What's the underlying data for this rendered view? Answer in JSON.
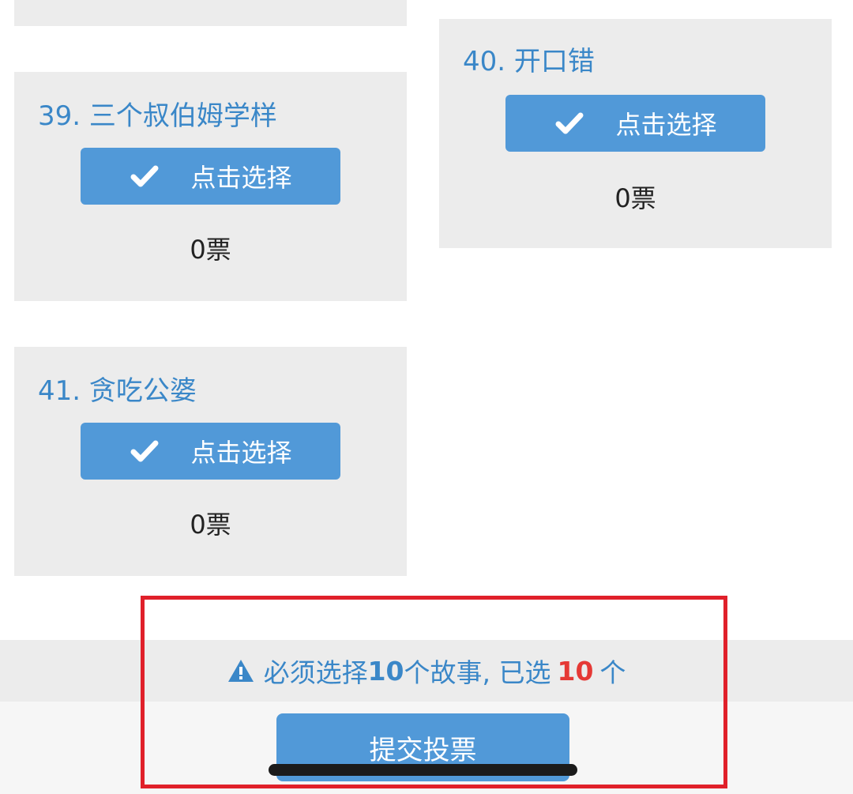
{
  "stories": [
    {
      "title": "39. 三个叔伯姆学样",
      "select_label": "点击选择",
      "votes": "0票"
    },
    {
      "title": "40. 开口错",
      "select_label": "点击选择",
      "votes": "0票"
    },
    {
      "title": "41. 贪吃公婆",
      "select_label": "点击选择",
      "votes": "0票"
    }
  ],
  "notice": {
    "prefix": "必须选择",
    "required_count": "10",
    "middle": "个故事, 已选",
    "selected_count": "10",
    "suffix": "个"
  },
  "submit_label": "提交投票",
  "colors": {
    "accent": "#5199d8",
    "title_text": "#3a87c8",
    "card_bg": "#ececec",
    "highlight_border": "#e0202a",
    "selected_count": "#e53935"
  },
  "icons": {
    "select": "check-icon",
    "notice": "warning-icon"
  }
}
